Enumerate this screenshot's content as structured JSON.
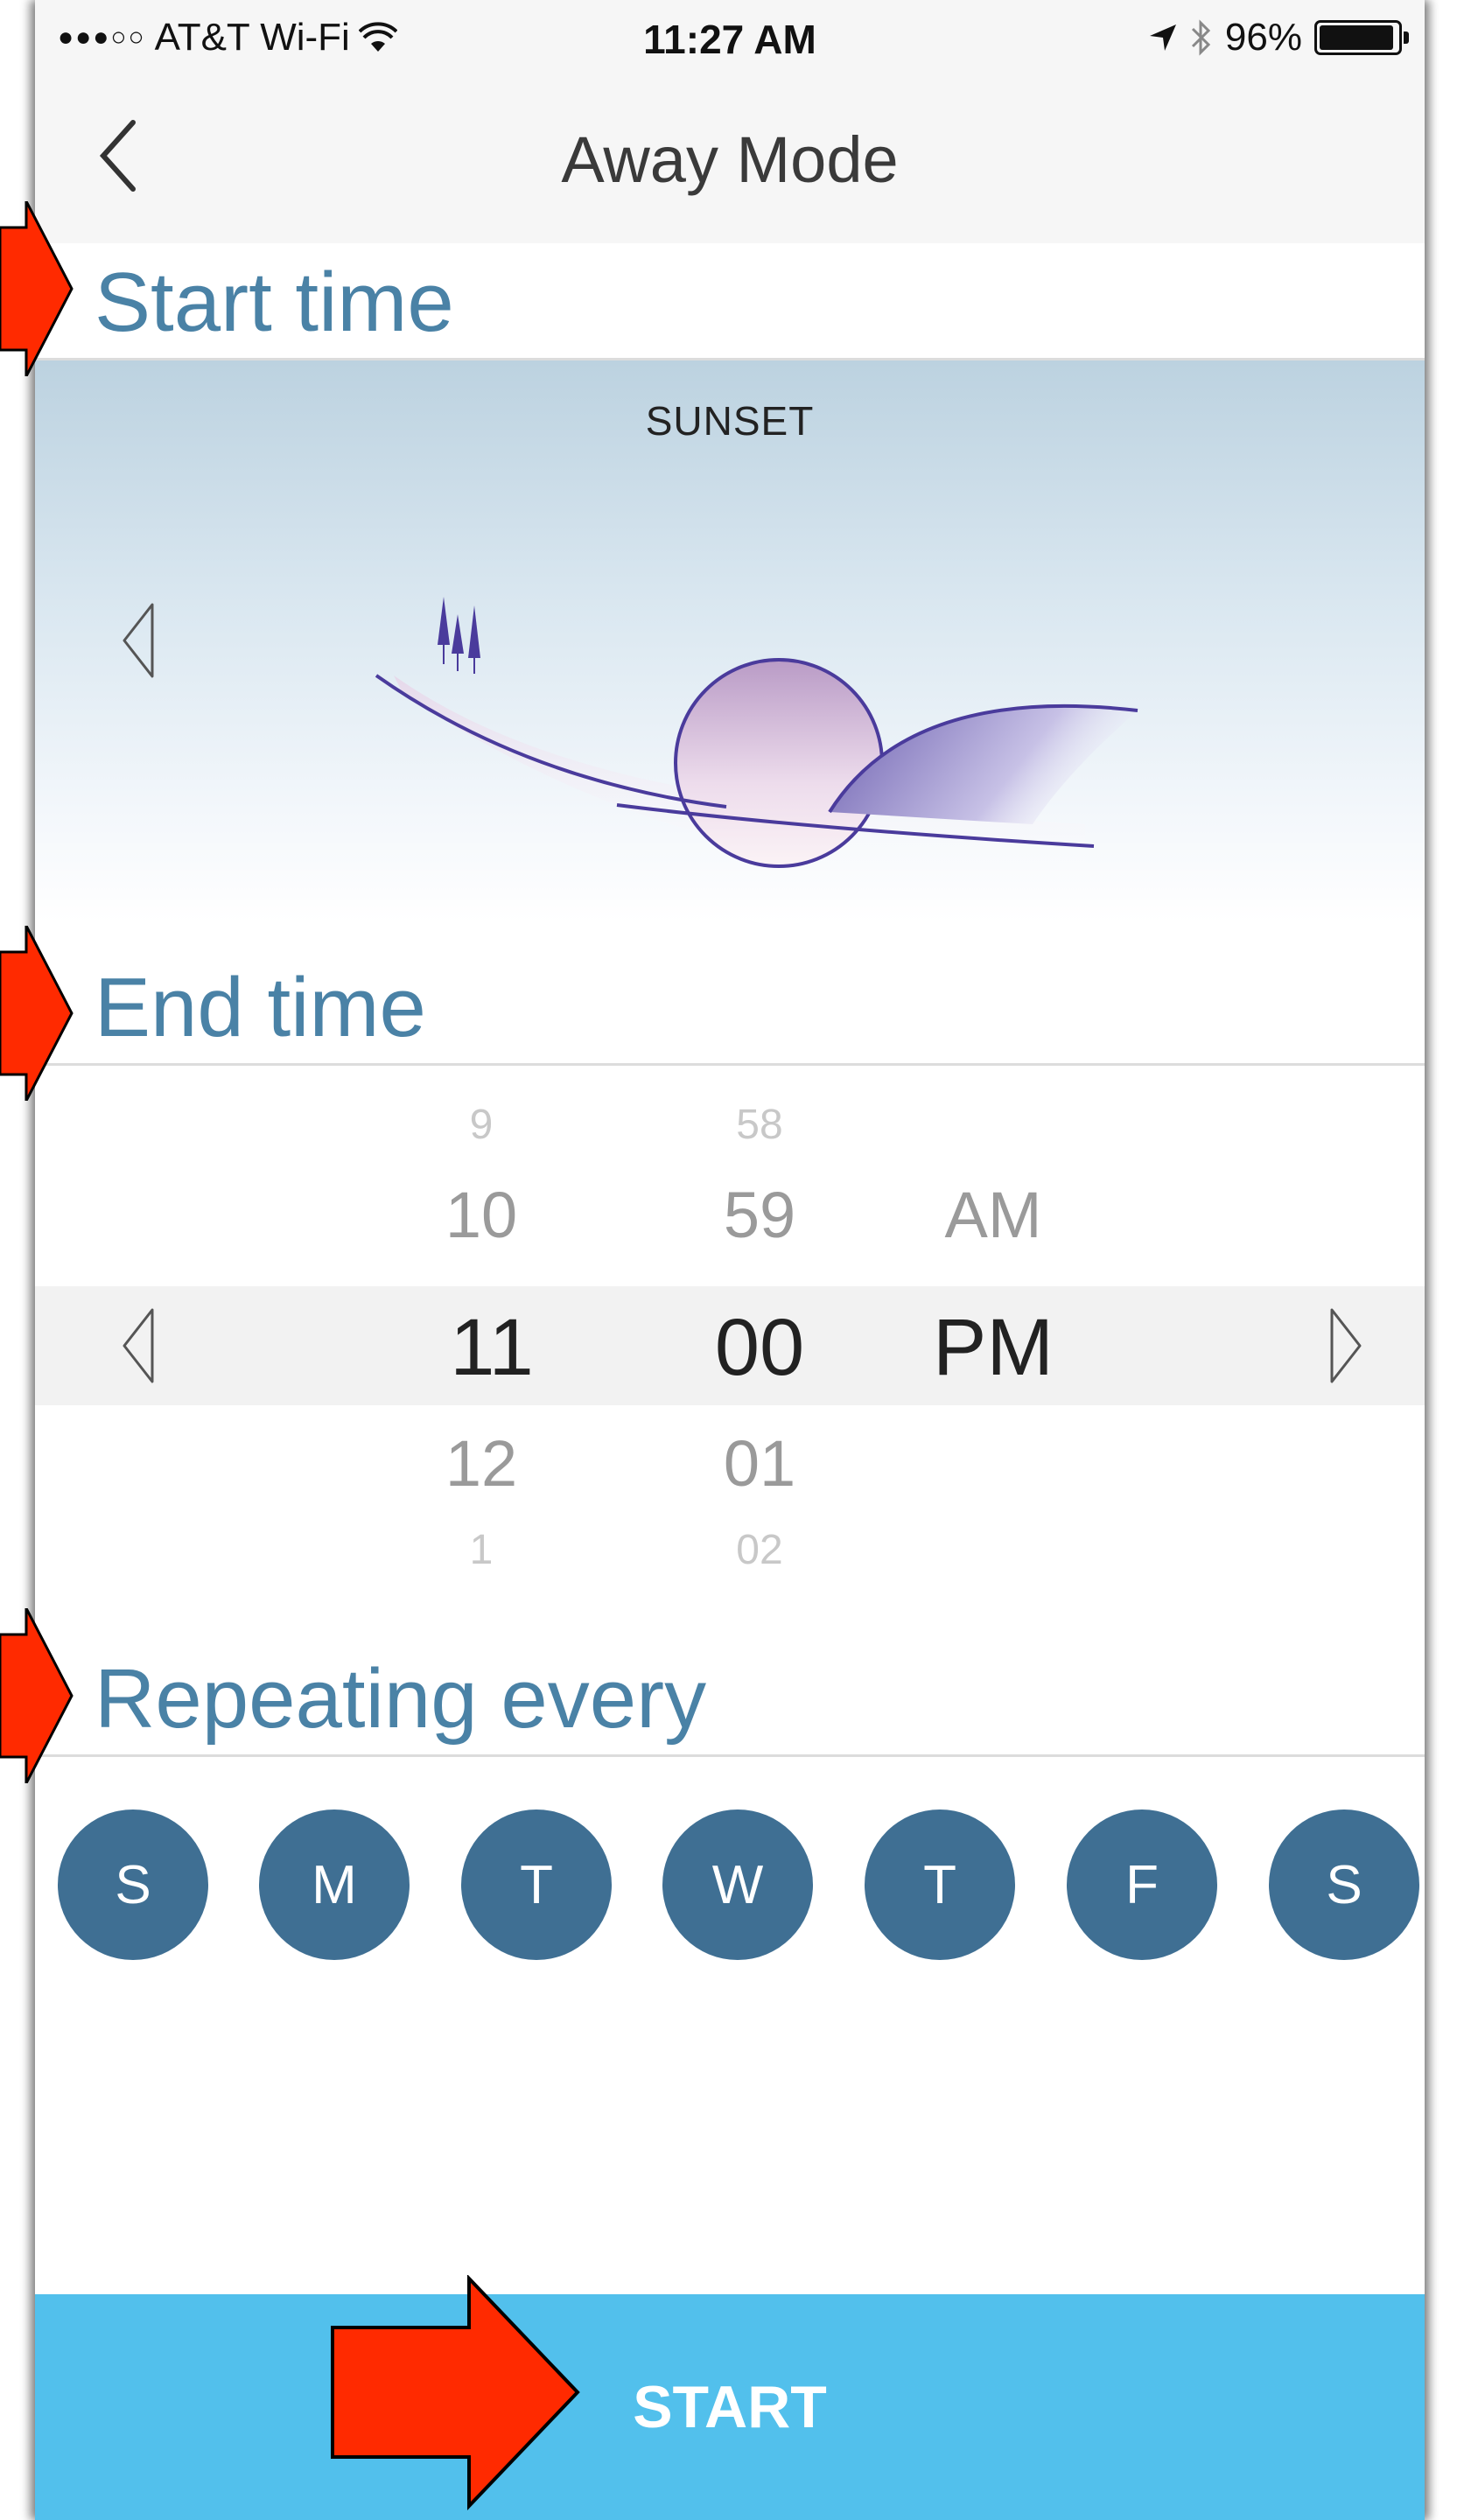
{
  "status_bar": {
    "signal": "●●●○○",
    "carrier": "AT&T Wi-Fi",
    "time": "11:27 AM",
    "battery_percent": "96%",
    "battery_level": 0.96
  },
  "nav": {
    "title": "Away Mode"
  },
  "start_time": {
    "header": "Start time",
    "option_label": "SUNSET"
  },
  "end_time": {
    "header": "End time",
    "hours": [
      "9",
      "10",
      "11",
      "12",
      "1"
    ],
    "minutes": [
      "58",
      "59",
      "00",
      "01",
      "02"
    ],
    "periods": [
      "AM",
      "PM"
    ],
    "selected": {
      "hour": "11",
      "minute": "00",
      "period": "PM"
    }
  },
  "repeat": {
    "header": "Repeating every",
    "days": [
      "S",
      "M",
      "T",
      "W",
      "T",
      "F",
      "S"
    ]
  },
  "start_button": {
    "label": "START"
  },
  "colors": {
    "accent_text": "#4a82a6",
    "day_circle": "#3f6f93",
    "start_button": "#52c0ec",
    "annotation_arrow": "#ff2a00"
  },
  "icons": {
    "back": "chevron-left-icon",
    "prev": "triangle-left-icon",
    "next": "triangle-right-icon"
  }
}
